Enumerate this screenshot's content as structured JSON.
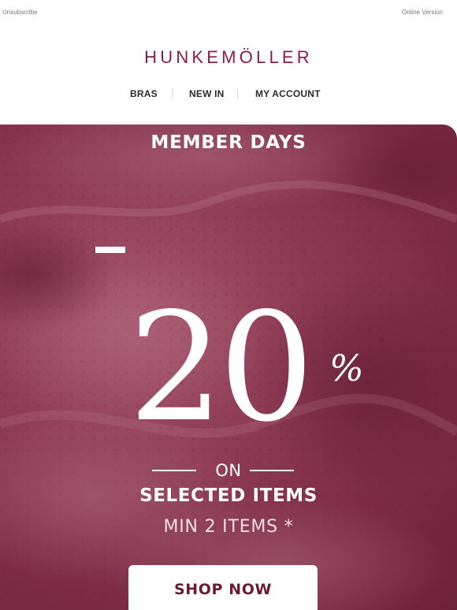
{
  "header": {
    "unsubscribe": "Unsubscribe",
    "online_version": "Online Version",
    "brand": "HUNKEMÖLLER"
  },
  "nav": {
    "items": [
      "BRAS",
      "NEW IN",
      "MY ACCOUNT"
    ]
  },
  "hero": {
    "title": "MEMBER DAYS",
    "discount_minus": "-",
    "discount_number": "20",
    "discount_sign": "%",
    "on": "ON",
    "selected": "SELECTED ITEMS",
    "condition": "MIN 2 ITEMS *",
    "cta": "SHOP NOW"
  },
  "colors": {
    "brand": "#8c1d4a",
    "hero_background": "#8a3a52",
    "cta_text": "#6d1a33"
  }
}
